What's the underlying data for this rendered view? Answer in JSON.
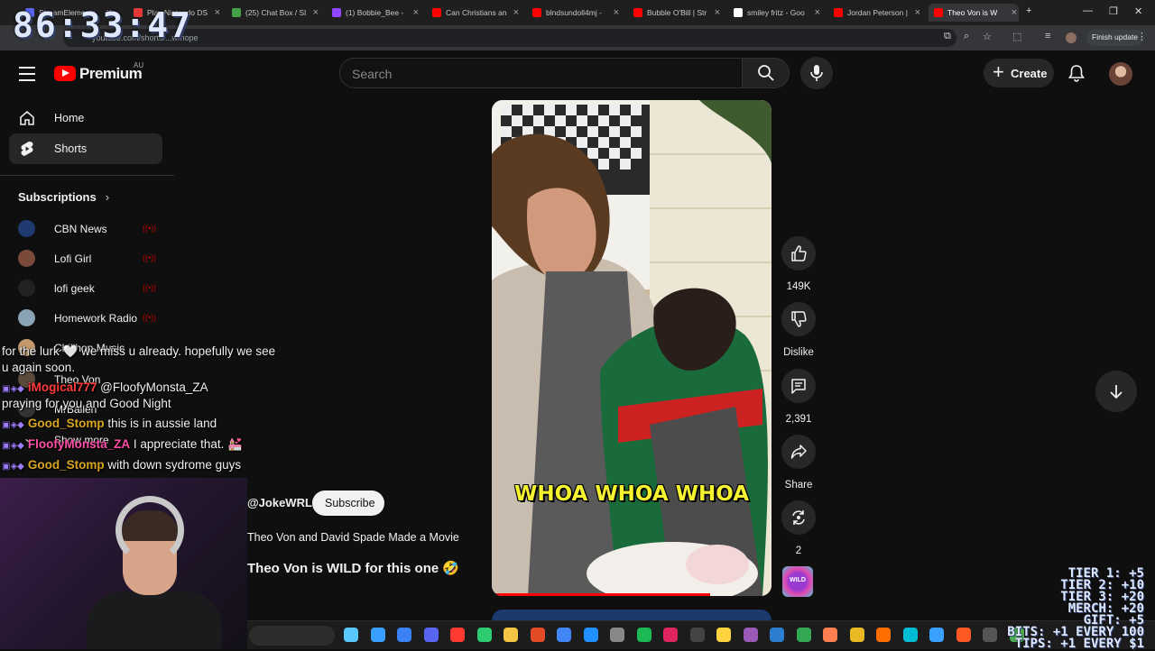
{
  "browser": {
    "tabs": [
      {
        "label": "StreamElements",
        "color": "#5865f2"
      },
      {
        "label": "Play Nintendo DS",
        "color": "#e53935"
      },
      {
        "label": "(25) Chat Box / Sl",
        "color": "#43a047"
      },
      {
        "label": "(1) Bobbie_Bee -",
        "color": "#9146ff"
      },
      {
        "label": "Can Christians an",
        "color": "#ff0000"
      },
      {
        "label": "blndsundoll4mj -",
        "color": "#ff0000"
      },
      {
        "label": "Bubble O'Bill | Str",
        "color": "#ff0000"
      },
      {
        "label": "smiley fritz - Goo",
        "color": "#ffffff"
      },
      {
        "label": "Jordan Peterson |",
        "color": "#ff0000"
      },
      {
        "label": "Theo Von is W",
        "color": "#ff0000"
      }
    ],
    "address": "youtube.com/shorts/...wmope",
    "finish_update": "Finish update"
  },
  "overlay": {
    "clock": "86:33:47",
    "tiers": [
      "TIER 1: +5",
      "TIER 2: +10",
      "TIER 3: +20",
      "MERCH: +20",
      "GIFT: +5",
      "BITS: +1 EVERY 100",
      "TIPS: +1 EVERY $1"
    ]
  },
  "header": {
    "brand": "Premium",
    "country": "AU",
    "search_placeholder": "Search",
    "create_label": "Create"
  },
  "sidebar": {
    "home": "Home",
    "shorts": "Shorts",
    "subscriptions": "Subscriptions",
    "subs": [
      {
        "name": "CBN News",
        "color": "#1e3a6e"
      },
      {
        "name": "Lofi Girl",
        "color": "#7a4a3a"
      },
      {
        "name": "lofi geek",
        "color": "#222"
      },
      {
        "name": "Homework Radio",
        "color": "#8aa3b5"
      },
      {
        "name": "Chillhop Music",
        "color": "#c49a6c"
      },
      {
        "name": "Theo Von",
        "color": "#5a4a3a"
      },
      {
        "name": "MrBallen",
        "color": "#333"
      }
    ],
    "show_more": "Show more"
  },
  "short": {
    "caption": "WHOA WHOA WHOA",
    "progress": 0.78,
    "likes": "149K",
    "dislike": "Dislike",
    "comments": "2,391",
    "share": "Share",
    "remix": "2",
    "channel_thumb": "WILD",
    "channel": "@JokeWRLD",
    "subscribe": "Subscribe",
    "related": "Theo Von and David Spade Made a Movie",
    "title": "Theo Von is WILD for this one 🤣"
  },
  "chat": [
    {
      "user": "",
      "text": "for the lurk 🤍 we miss u already. hopefully we see"
    },
    {
      "user": "",
      "text": "u again soon."
    },
    {
      "user": "iMogical777",
      "text": "@FloofyMonsta_ZA",
      "color": "#ff3b3b"
    },
    {
      "user": "",
      "text": "praying for you and Good Night"
    },
    {
      "user": "Good_Stomp",
      "text": "this is in aussie land",
      "color": "#daa520"
    },
    {
      "user": "FloofyMonsta_ZA",
      "text": "I appreciate that. 💒",
      "color": "#ff4fa8"
    },
    {
      "user": "Good_Stomp",
      "text": "with down sydrome guys",
      "color": "#daa520"
    }
  ]
}
